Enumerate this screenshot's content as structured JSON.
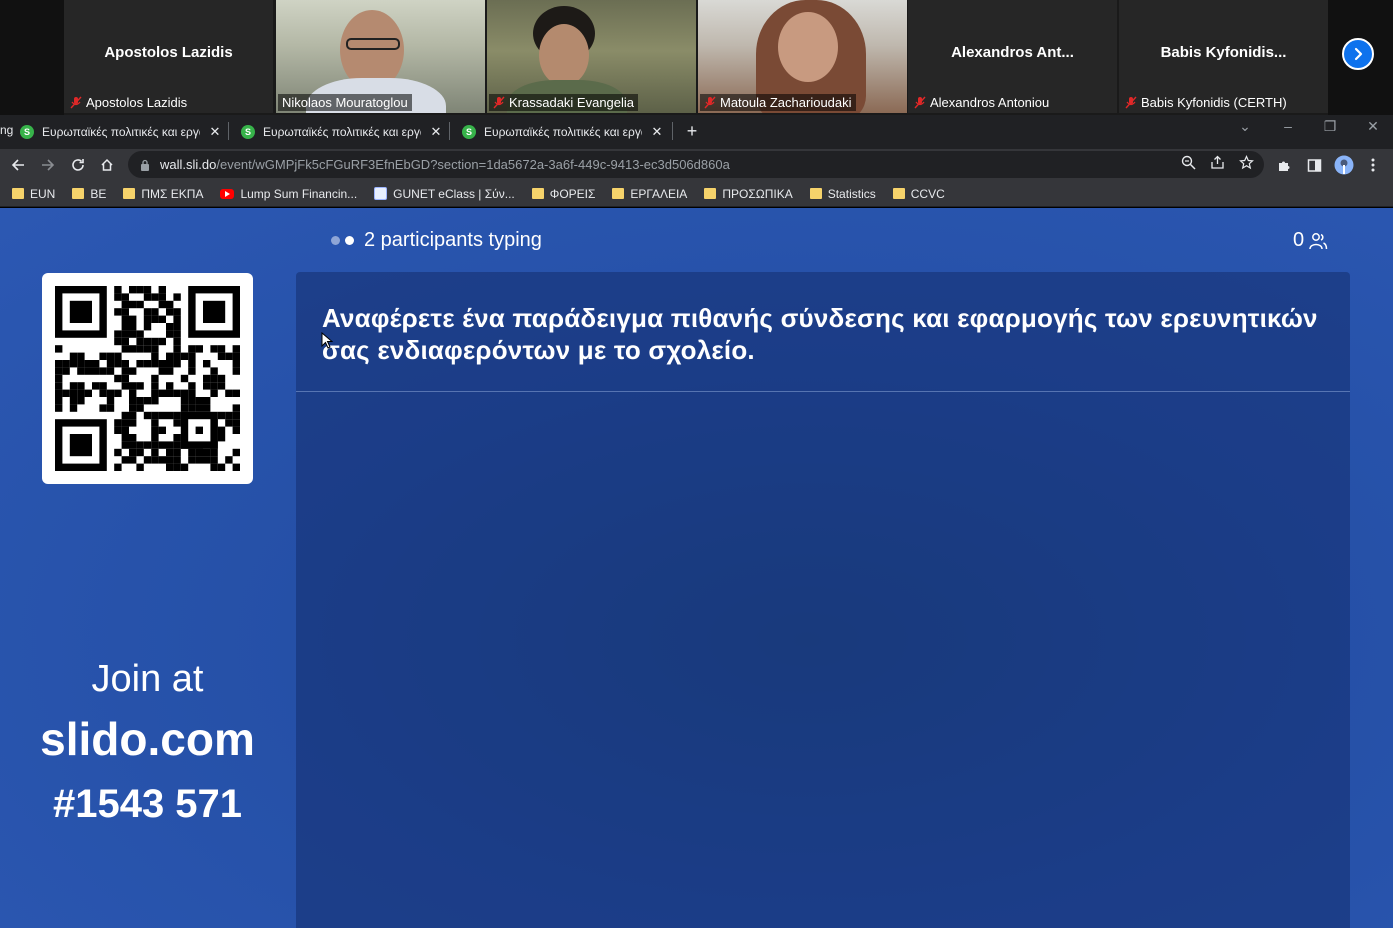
{
  "zoom": {
    "participants": [
      {
        "center_name": "Apostolos Lazidis",
        "label": "Apostolos Lazidis",
        "video": false,
        "muted": true
      },
      {
        "center_name": "",
        "label": "Nikolaos Mouratoglou",
        "video": true,
        "muted": false
      },
      {
        "center_name": "",
        "label": "Krassadaki Evangelia",
        "video": true,
        "muted": true
      },
      {
        "center_name": "",
        "label": "Matoula Zacharioudaki",
        "video": true,
        "muted": true
      },
      {
        "center_name": "Alexandros Ant...",
        "label": "Alexandros Antoniou",
        "video": false,
        "muted": true
      },
      {
        "center_name": "Babis  Kyfonidis...",
        "label": "Babis Kyfonidis (CERTH)",
        "video": false,
        "muted": true
      }
    ],
    "next_icon": "chevron-right-icon",
    "accent": "#0e72ed"
  },
  "browser": {
    "partial_tab_text": "ng",
    "tabs": [
      {
        "title": "Ευρωπαϊκές πολιτικές και εργαλεία",
        "favicon": "S",
        "active": false
      },
      {
        "title": "Ευρωπαϊκές πολιτικές και εργαλεία",
        "favicon": "S",
        "active": false
      },
      {
        "title": "Ευρωπαϊκές πολιτικές και εργαλεία",
        "favicon": "S",
        "active": true
      }
    ],
    "url_host": "wall.sli.do",
    "url_path": "/event/wGMPjFk5cFGuRF3EfnEbGD?section=1da5672a-3a6f-449c-9413-ec3d506d860a",
    "bookmarks": [
      {
        "label": "EUN",
        "icon": "folder"
      },
      {
        "label": "BE",
        "icon": "folder"
      },
      {
        "label": "ΠΜΣ ΕΚΠΑ",
        "icon": "folder"
      },
      {
        "label": "Lump Sum Financin...",
        "icon": "youtube"
      },
      {
        "label": "GUNET eClass | Σύν...",
        "icon": "gunet"
      },
      {
        "label": "ΦΟΡΕΙΣ",
        "icon": "folder"
      },
      {
        "label": "ΕΡΓΑΛΕΙΑ",
        "icon": "folder"
      },
      {
        "label": "ΠΡΟΣΩΠΙΚΑ",
        "icon": "folder"
      },
      {
        "label": "Statistics",
        "icon": "folder"
      },
      {
        "label": "CCVC",
        "icon": "folder"
      }
    ]
  },
  "slido": {
    "typing_text": "2 participants typing",
    "participant_count": "0",
    "join_line1": "Join at",
    "join_line2": "slido.com",
    "join_line3": "#1543 571",
    "question": "Αναφέρετε ένα παράδειγμα πιθανής σύνδεσης και εφαρμογής των ερευνητικών σας ενδιαφερόντων με το σχολείο."
  }
}
